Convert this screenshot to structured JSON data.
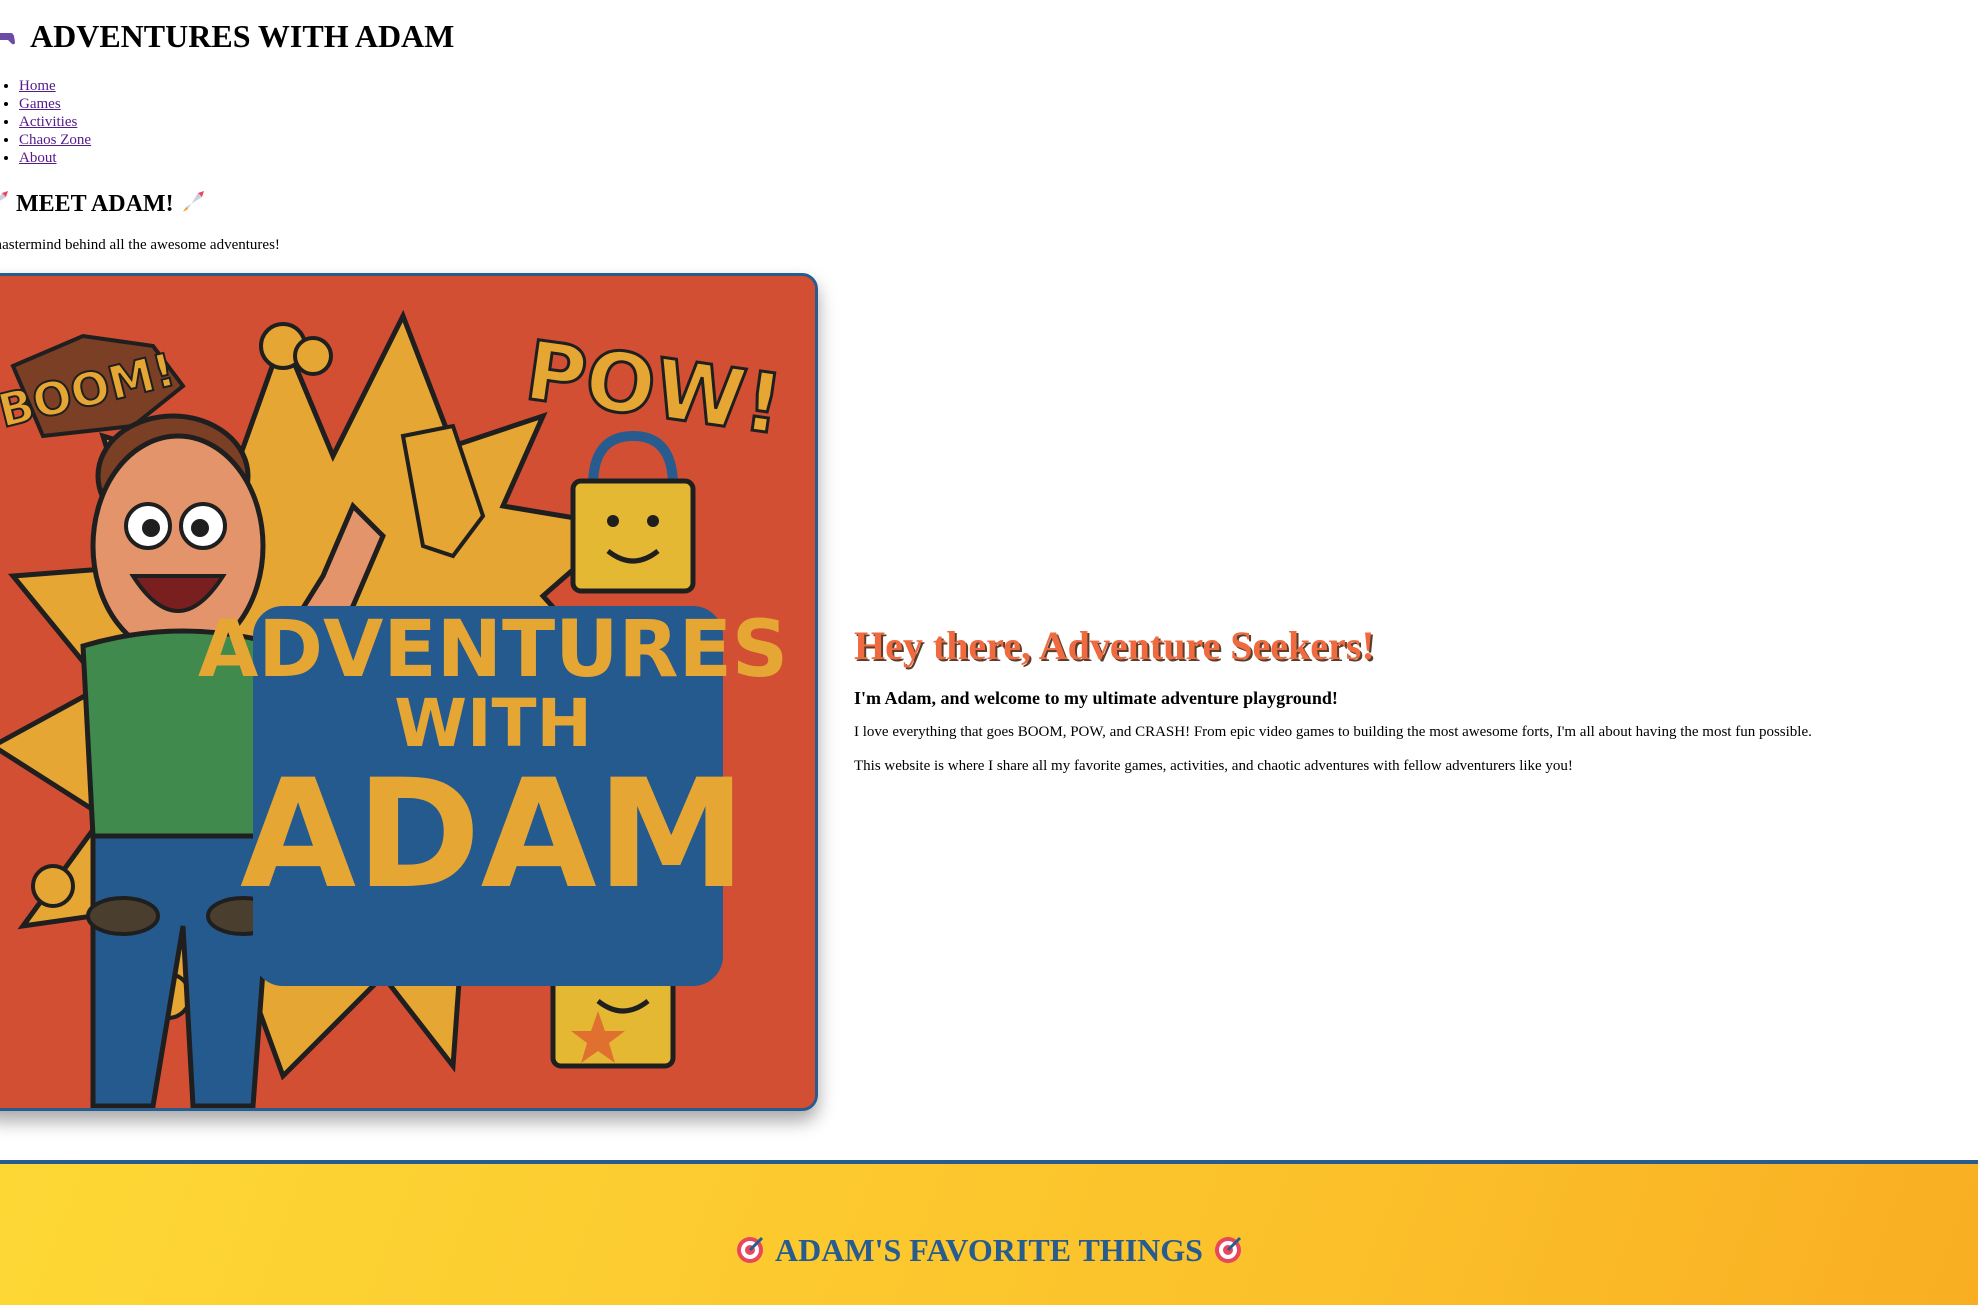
{
  "site": {
    "title": "ADVENTURES WITH ADAM",
    "title_icon": "game-controller-icon"
  },
  "nav": {
    "items": [
      {
        "label": "Home"
      },
      {
        "label": "Games"
      },
      {
        "label": "Activities"
      },
      {
        "label": "Chaos Zone"
      },
      {
        "label": "About"
      }
    ]
  },
  "meet": {
    "title": "MEET ADAM!",
    "title_icon": "rocket-icon",
    "subtitle": "e mastermind behind all the awesome adventures!"
  },
  "hero_image": {
    "texts": {
      "boom": "BOOM!",
      "pow": "POW!",
      "line1": "ADVENTURES",
      "line2": "WITH",
      "line3": "ADAM"
    }
  },
  "intro": {
    "heading": "Hey there, Adventure Seekers!",
    "subheading": "I'm Adam, and welcome to my ultimate adventure playground!",
    "paragraph1": "I love everything that goes BOOM, POW, and CRASH! From epic video games to building the most awesome forts, I'm all about having the most fun possible.",
    "paragraph2": "This website is where I share all my favorite games, activities, and chaotic adventures with fellow adventurers like you!"
  },
  "favorites": {
    "title": "ADAM'S FAVORITE THINGS",
    "title_icon": "target-icon"
  },
  "colors": {
    "link": "#551a8b",
    "accent_orange": "#ef6a3f",
    "accent_blue": "#285c8f",
    "banner_yellow": "#fbbf2a",
    "hero_red": "#d24f34"
  }
}
